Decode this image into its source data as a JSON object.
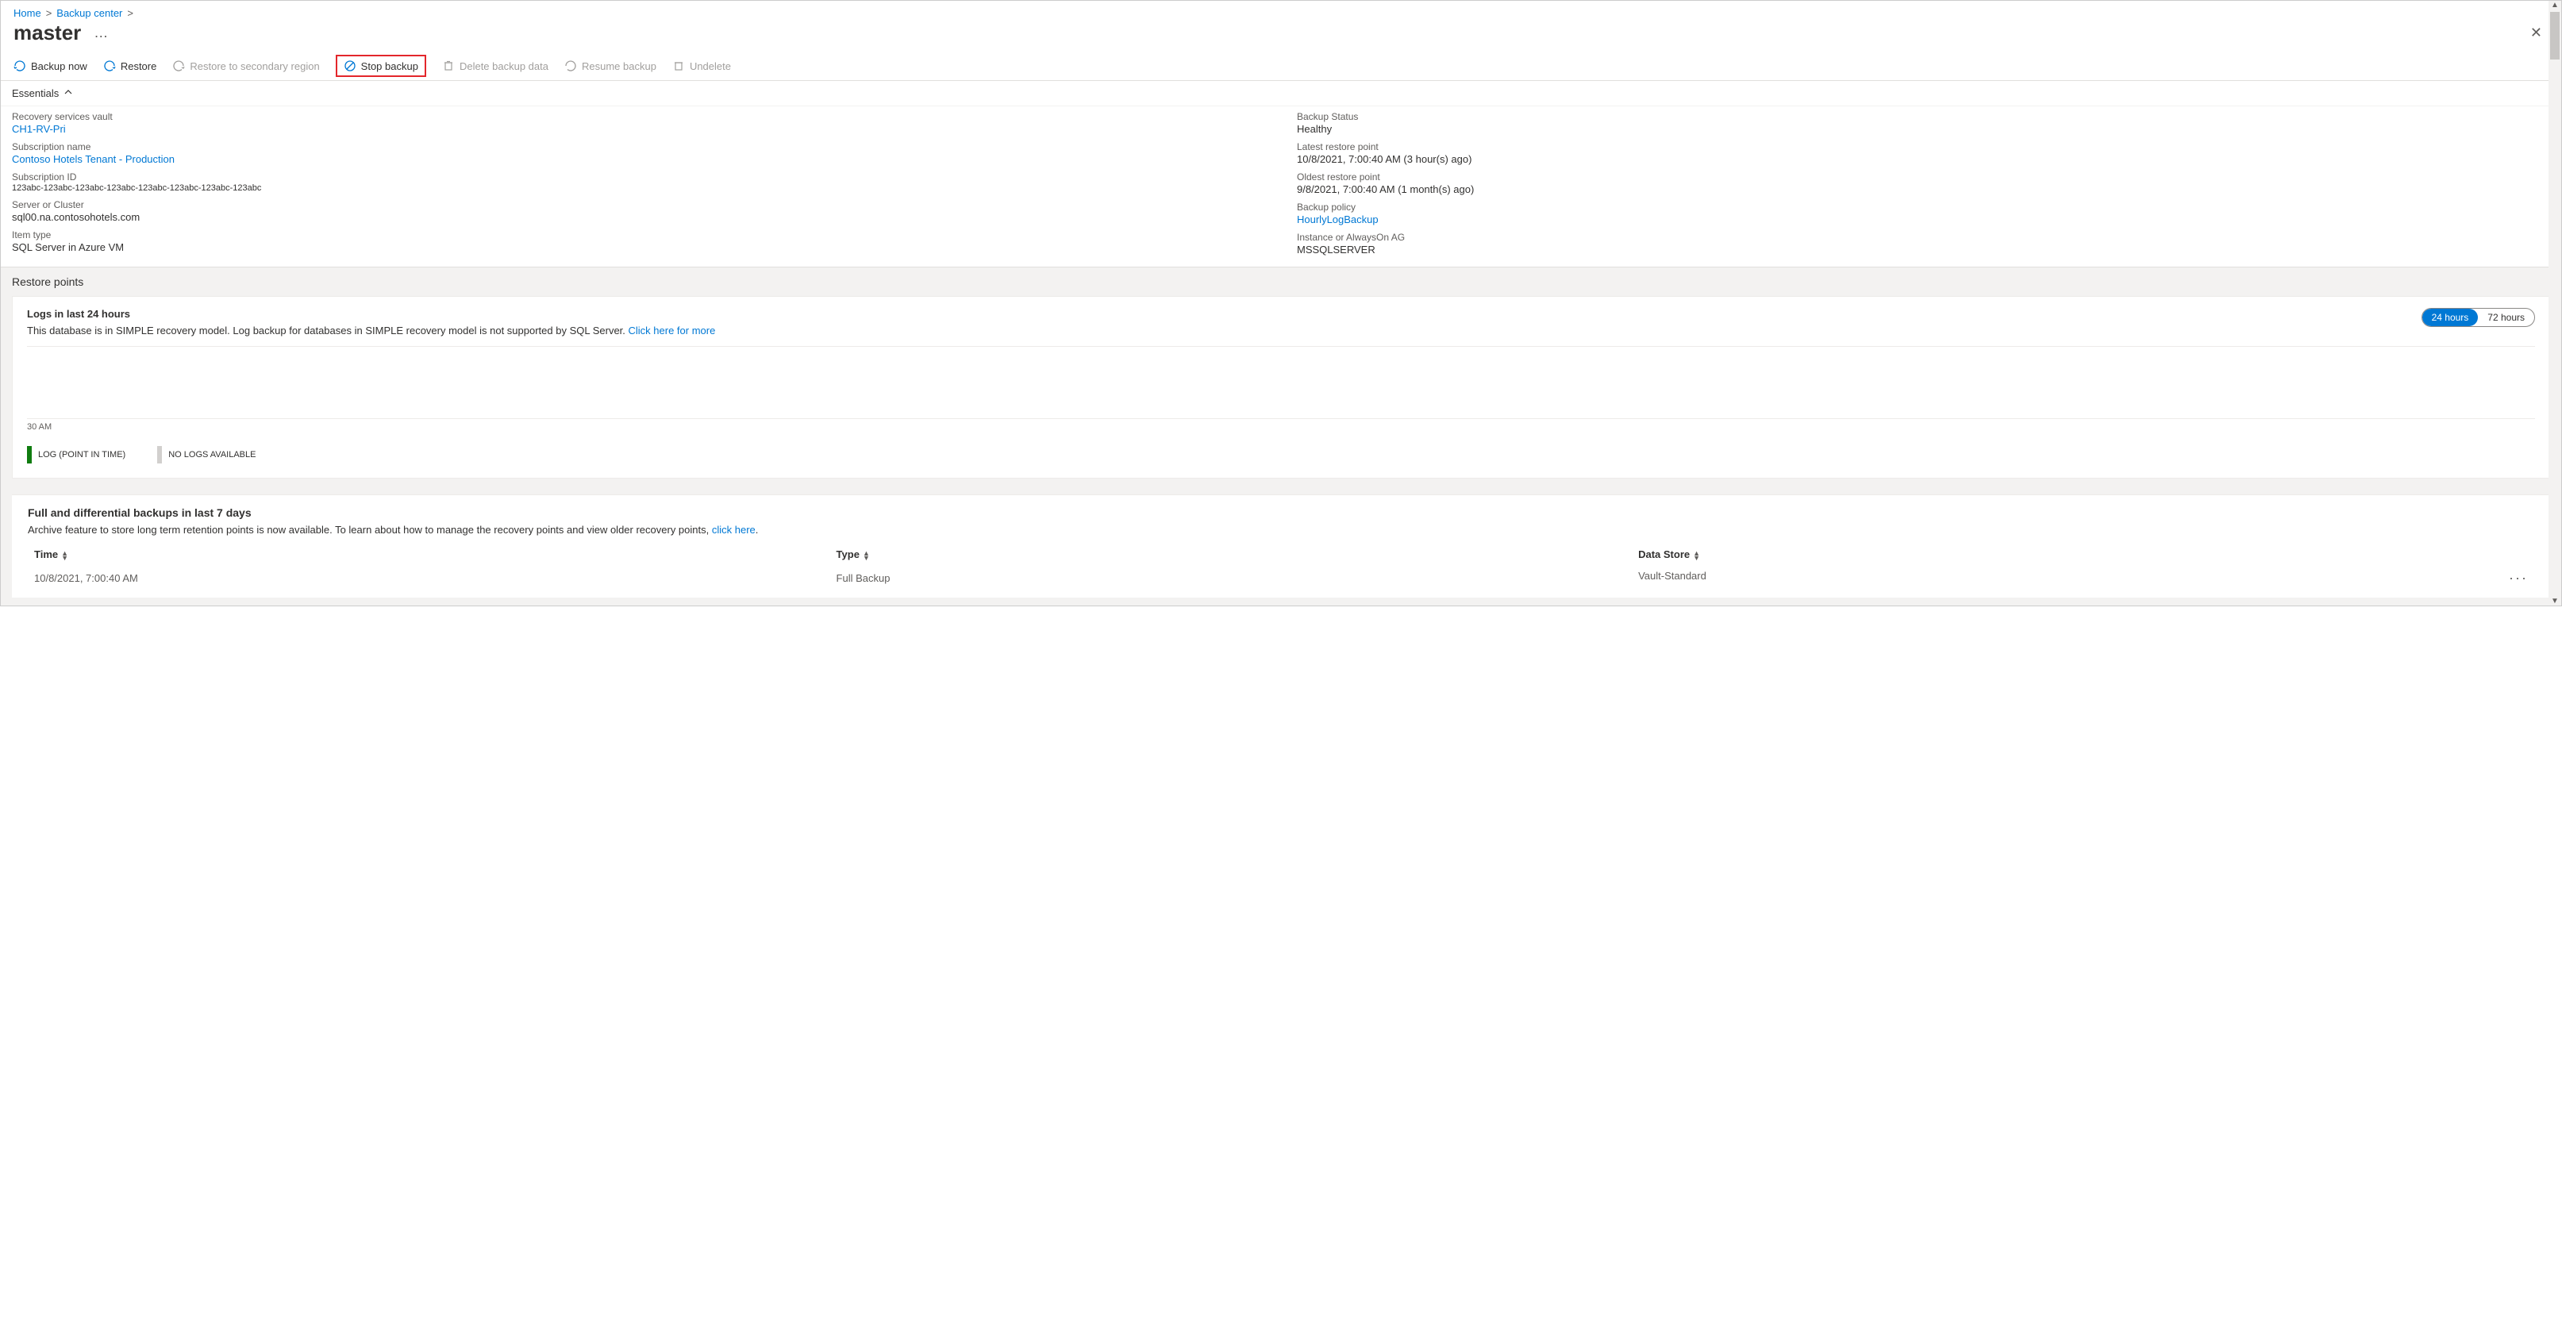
{
  "breadcrumb": {
    "home": "Home",
    "backup_center": "Backup center"
  },
  "page": {
    "title": "master"
  },
  "toolbar": {
    "backup_now": "Backup now",
    "restore": "Restore",
    "restore_secondary": "Restore to secondary region",
    "stop_backup": "Stop backup",
    "delete_backup_data": "Delete backup data",
    "resume_backup": "Resume backup",
    "undelete": "Undelete"
  },
  "essentials": {
    "header": "Essentials",
    "left": [
      {
        "label": "Recovery services vault",
        "value": "CH1-RV-Pri",
        "link": true
      },
      {
        "label": "Subscription name",
        "value": "Contoso Hotels Tenant - Production",
        "link": true
      },
      {
        "label": "Subscription ID",
        "value": "123abc-123abc-123abc-123abc-123abc-123abc-123abc-123abc",
        "small": true
      },
      {
        "label": "Server or Cluster",
        "value": "sql00.na.contosohotels.com"
      },
      {
        "label": "Item type",
        "value": "SQL Server in Azure VM"
      }
    ],
    "right": [
      {
        "label": "Backup Status",
        "value": "Healthy"
      },
      {
        "label": "Latest restore point",
        "value": "10/8/2021, 7:00:40 AM (3 hour(s) ago)"
      },
      {
        "label": "Oldest restore point",
        "value": "9/8/2021, 7:00:40 AM (1 month(s) ago)"
      },
      {
        "label": "Backup policy",
        "value": "HourlyLogBackup",
        "link": true
      },
      {
        "label": "Instance or AlwaysOn AG",
        "value": "MSSQLSERVER"
      }
    ]
  },
  "restore": {
    "section_title": "Restore points",
    "logs_title": "Logs in last 24 hours",
    "logs_desc": "This database is in SIMPLE recovery model. Log backup for databases in SIMPLE recovery model is not supported by SQL Server. ",
    "logs_link": "Click here for more",
    "toggle_24": "24 hours",
    "toggle_72": "72 hours",
    "axis_label": "30 AM",
    "legend_log": "LOG (POINT IN TIME)",
    "legend_none": "NO LOGS AVAILABLE"
  },
  "backups_table": {
    "title": "Full and differential backups in last 7 days",
    "desc": "Archive feature to store long term retention points is now available. To learn about how to manage the recovery points and view older recovery points, ",
    "link": "click here",
    "headers": {
      "time": "Time",
      "type": "Type",
      "datastore": "Data Store"
    },
    "rows": [
      {
        "time": "10/8/2021, 7:00:40 AM",
        "type": "Full Backup",
        "datastore": "Vault-Standard"
      }
    ]
  },
  "chart_data": {
    "type": "bar",
    "title": "Logs in last 24 hours",
    "categories": [
      "30 AM"
    ],
    "series": [
      {
        "name": "LOG (POINT IN TIME)",
        "values": []
      },
      {
        "name": "NO LOGS AVAILABLE",
        "values": []
      }
    ],
    "note": "No log data present because database is in SIMPLE recovery model",
    "xlabel": "",
    "ylabel": ""
  }
}
